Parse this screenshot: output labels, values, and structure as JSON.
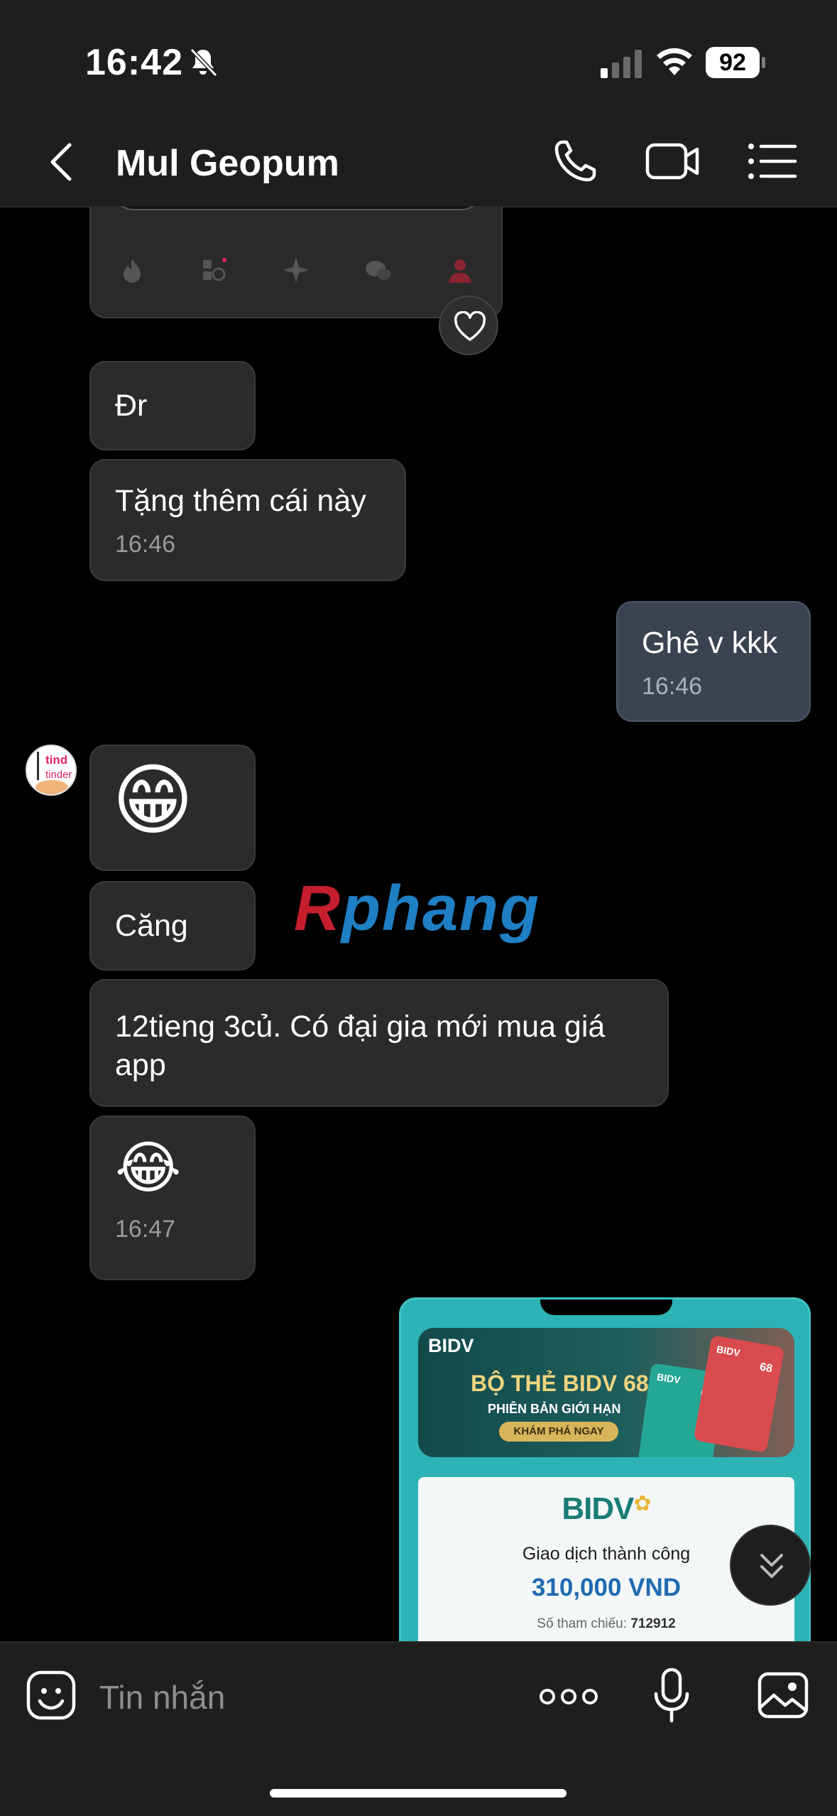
{
  "status_bar": {
    "time": "16:42",
    "battery": "92"
  },
  "header": {
    "title": "Mul Geopum"
  },
  "messages": {
    "m1": {
      "text": "Đr"
    },
    "m2": {
      "text": "Tặng thêm cái này",
      "time": "16:46"
    },
    "m3": {
      "text": "Ghê v kkk",
      "time": "16:46"
    },
    "m4": {
      "text": "😁"
    },
    "m5": {
      "text": "Căng"
    },
    "m6": {
      "text": "12tieng 3củ. Có đại gia mới mua giá app"
    },
    "m7": {
      "text": "😂",
      "time": "16:47"
    }
  },
  "avatar": {
    "line1": "tind",
    "line2": "tinder"
  },
  "watermark": {
    "first": "R",
    "rest": "phang"
  },
  "receipt": {
    "banner_logo": "BIDV",
    "banner_headline": "BỘ THẺ BIDV 68",
    "banner_sub": "PHIÊN BẢN GIỚI HẠN",
    "banner_cta": "KHÁM PHÁ NGAY",
    "card_brand": "BIDV",
    "card_number": "68",
    "logo": "BIDV",
    "status": "Giao dịch thành công",
    "amount": "310,000 VND",
    "ref_label": "Số tham chiếu:",
    "ref_value": "712912"
  },
  "composer": {
    "placeholder": "Tin nhắn"
  },
  "colors": {
    "incoming_bubble": "#2b2b2b",
    "outgoing_bubble": "#3a4350",
    "bidv_teal": "#2db3b6",
    "amount_blue": "#1f6bb2"
  }
}
